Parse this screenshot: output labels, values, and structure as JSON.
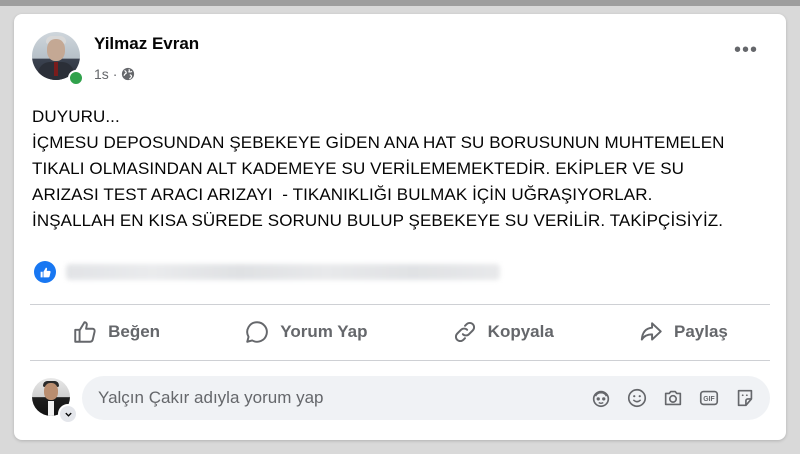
{
  "post": {
    "author": "Yilmaz Evran",
    "time": "1s",
    "text_lines": [
      "DUYURU...",
      "İÇMESU DEPOSUNDAN ŞEBEKEYE GİDEN ANA HAT SU BORUSUNUN MUHTEMELEN",
      "TIKALI OLMASINDAN ALT KADEMEYE SU VERİLEMEMEKTEDİR. EKİPLER VE SU",
      "ARIZASI TEST ARACI ARIZAYI  - TIKANIKLIĞI BULMAK İÇİN UĞRAŞIYORLAR.",
      "İNŞALLAH EN KISA SÜREDE SORUNU BULUP ŞEBEKEYE SU VERİLİR. TAKİPÇİSİYİZ."
    ],
    "privacy_icon": "globe-icon",
    "more_icon": "more-dots-icon"
  },
  "actions": {
    "like_label": "Beğen",
    "comment_label": "Yorum Yap",
    "copy_label": "Kopyala",
    "share_label": "Paylaş"
  },
  "comment": {
    "placeholder": "Yalçın Çakır adıyla yorum yap",
    "icons": [
      "avatar-sticker-icon",
      "emoji-icon",
      "camera-icon",
      "gif-icon",
      "sticker-icon"
    ]
  },
  "colors": {
    "brand_blue": "#1877f2",
    "secondary_text": "#65676b",
    "online_green": "#31a24c"
  }
}
